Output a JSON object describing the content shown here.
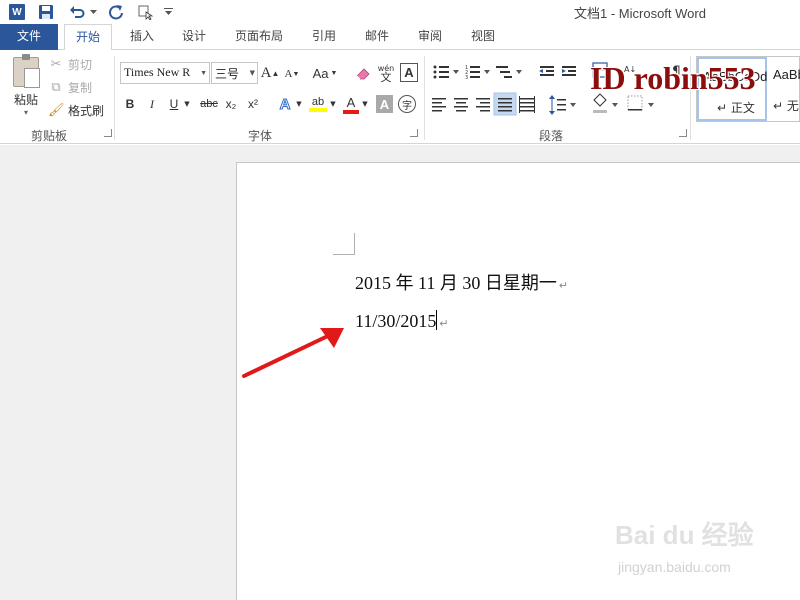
{
  "window": {
    "title": "文档1 - Microsoft Word",
    "app_logo_letter": "W"
  },
  "quick_access": {
    "items": [
      "word-logo",
      "save-icon",
      "undo-icon",
      "redo-icon",
      "touch-mode-icon",
      "customize-icon"
    ]
  },
  "tabs": [
    {
      "label": "文件"
    },
    {
      "label": "开始"
    },
    {
      "label": "插入"
    },
    {
      "label": "设计"
    },
    {
      "label": "页面布局"
    },
    {
      "label": "引用"
    },
    {
      "label": "邮件"
    },
    {
      "label": "审阅"
    },
    {
      "label": "视图"
    }
  ],
  "clipboard": {
    "group_label": "剪贴板",
    "paste_label": "粘贴",
    "cut_label": "剪切",
    "copy_label": "复制",
    "format_painter_label": "格式刷"
  },
  "font": {
    "group_label": "字体",
    "font_name": "Times New R",
    "font_size": "三号",
    "grow_label": "A",
    "shrink_label": "A",
    "case_label": "Aa",
    "pinyin_label": "wén",
    "border_char_label": "A",
    "bold": "B",
    "italic": "I",
    "underline": "U",
    "strike": "abc",
    "subscript": "x₂",
    "superscript": "x²",
    "effects": "A",
    "highlight": "ab",
    "font_color": "A",
    "shading": "A",
    "enclose": "字"
  },
  "paragraph": {
    "group_label": "段落"
  },
  "styles": {
    "items": [
      {
        "sample": "AaBbCcDd",
        "name": "↵ 正文"
      },
      {
        "sample": "AaBb",
        "name": "↵ 无"
      }
    ]
  },
  "watermark": {
    "top_text": "ID robin553",
    "baidu_text": "Bai du 经验",
    "baidu_url": "jingyan.baidu.com"
  },
  "document": {
    "lines": [
      {
        "text": "2015 年 11 月 30 日星期一",
        "mark": "↵"
      },
      {
        "text": "11/30/2015",
        "mark": "↵"
      }
    ]
  },
  "colors": {
    "accent": "#2b579a",
    "arrow": "#e01919",
    "highlight_yellow": "#ffff00",
    "font_red": "#e31b1b"
  }
}
